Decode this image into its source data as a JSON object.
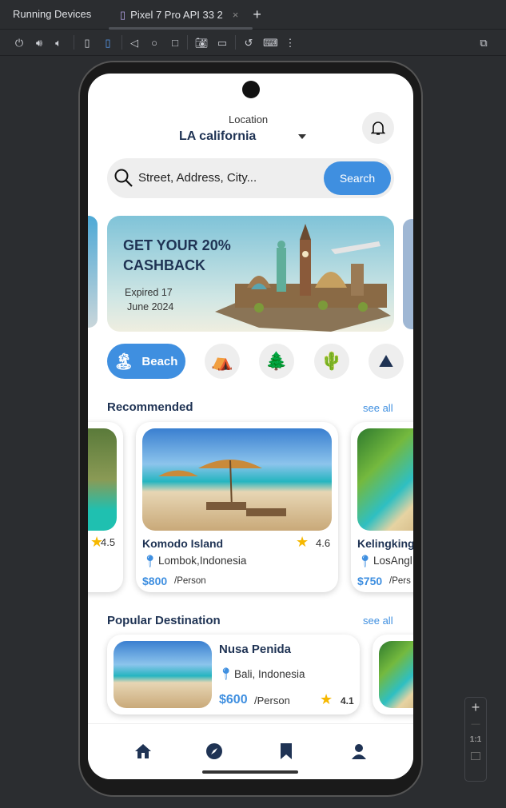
{
  "ide": {
    "panel_title": "Running Devices",
    "device_tab": "Pixel 7 Pro API 33 2",
    "toolbar_icons": [
      "power-icon",
      "volume-up-icon",
      "volume-down-icon",
      "rotate-left-icon",
      "rotate-right-icon",
      "back-icon",
      "home-icon",
      "overview-icon",
      "screenshot-icon",
      "screen-record-icon",
      "reset-icon",
      "keyboard-icon",
      "more-icon"
    ],
    "zoom_controls": {
      "plus": "+",
      "minus": "—",
      "actual": "1:1"
    }
  },
  "app": {
    "header": {
      "location_label": "Location",
      "location_value": "LA california"
    },
    "search": {
      "placeholder": "Street, Address, City...",
      "button": "Search"
    },
    "banner": {
      "title_line1": "GET YOUR 20%",
      "title_line2": "CASHBACK",
      "expiry_line1": "Expired 17",
      "expiry_line2": "June 2024"
    },
    "categories": [
      {
        "label": "Beach",
        "icon": "🏝",
        "selected": true
      },
      {
        "label": "",
        "icon": "⛺",
        "selected": false
      },
      {
        "label": "",
        "icon": "🌲",
        "selected": false
      },
      {
        "label": "",
        "icon": "🌵",
        "selected": false
      },
      {
        "label": "",
        "icon": "⛰",
        "selected": false
      }
    ],
    "recommended": {
      "title": "Recommended",
      "see_all": "see all",
      "items": [
        {
          "rating": "4.5"
        },
        {
          "name": "Komodo Island",
          "location": "Lombok,Indonesia",
          "price": "$800",
          "unit": "/Person",
          "rating": "4.6"
        },
        {
          "name": "Kelingking",
          "location": "LosAngl",
          "price": "$750",
          "unit": "/Pers"
        }
      ]
    },
    "popular": {
      "title": "Popular Destination",
      "see_all": "see all",
      "items": [
        {
          "name": "Nusa Penida",
          "location": "Bali, Indonesia",
          "price": "$600",
          "unit": "/Person",
          "rating": "4.1"
        }
      ]
    },
    "bottom_nav": [
      "home",
      "explore",
      "bookmarks",
      "profile"
    ],
    "colors": {
      "accent": "#3f8fe0",
      "text": "#1f3354",
      "star": "#f6b800"
    }
  }
}
